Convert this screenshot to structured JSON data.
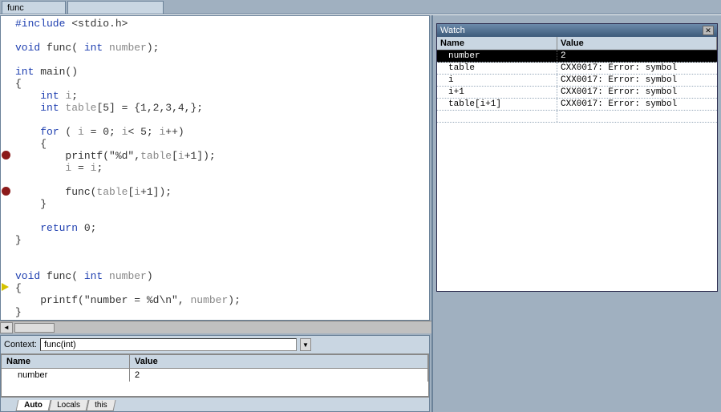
{
  "tabbar": {
    "active_tab": "func"
  },
  "code_lines": [
    {
      "indent": 0,
      "tokens": [
        [
          "kw",
          "#include"
        ],
        [
          "",
          ""
        ],
        [
          "str",
          " <stdio.h>"
        ]
      ]
    },
    {
      "indent": 0,
      "tokens": []
    },
    {
      "indent": 0,
      "tokens": [
        [
          "kw",
          "void"
        ],
        [
          "",
          " "
        ],
        [
          "",
          "func("
        ],
        [
          "",
          " "
        ],
        [
          "kw",
          "int"
        ],
        [
          "",
          " "
        ],
        [
          "gray",
          "number"
        ],
        [
          "",
          ");"
        ]
      ]
    },
    {
      "indent": 0,
      "tokens": []
    },
    {
      "indent": 0,
      "tokens": [
        [
          "kw",
          "int"
        ],
        [
          "",
          " "
        ],
        [
          "",
          "main()"
        ]
      ]
    },
    {
      "indent": 0,
      "tokens": [
        [
          "",
          "{"
        ]
      ]
    },
    {
      "indent": 1,
      "tokens": [
        [
          "kw",
          "int"
        ],
        [
          "",
          " "
        ],
        [
          "gray",
          "i"
        ],
        [
          "",
          ";"
        ]
      ]
    },
    {
      "indent": 1,
      "tokens": [
        [
          "kw",
          "int"
        ],
        [
          "",
          " "
        ],
        [
          "gray",
          "table"
        ],
        [
          "",
          "[5] = {1,2,3,4,};"
        ]
      ]
    },
    {
      "indent": 0,
      "tokens": []
    },
    {
      "indent": 1,
      "tokens": [
        [
          "kw",
          "for"
        ],
        [
          "",
          " ( "
        ],
        [
          "gray",
          "i"
        ],
        [
          "",
          " = 0; "
        ],
        [
          "gray",
          "i"
        ],
        [
          "",
          "< 5; "
        ],
        [
          "gray",
          "i"
        ],
        [
          "",
          "++)"
        ]
      ]
    },
    {
      "indent": 1,
      "tokens": [
        [
          "",
          "{"
        ]
      ]
    },
    {
      "indent": 2,
      "tokens": [
        [
          "",
          "printf("
        ],
        [
          "str",
          "\"%d\""
        ],
        [
          "",
          ","
        ],
        [
          "gray",
          "table"
        ],
        [
          "",
          "["
        ],
        [
          "gray",
          "i"
        ],
        [
          "",
          "+1]);"
        ]
      ],
      "bp": true
    },
    {
      "indent": 2,
      "tokens": [
        [
          "gray",
          "i"
        ],
        [
          "",
          " = "
        ],
        [
          "gray",
          "i"
        ],
        [
          "",
          ";"
        ]
      ]
    },
    {
      "indent": 0,
      "tokens": []
    },
    {
      "indent": 2,
      "tokens": [
        [
          "",
          "func("
        ],
        [
          "gray",
          "table"
        ],
        [
          "",
          "["
        ],
        [
          "gray",
          "i"
        ],
        [
          "",
          "+1]);"
        ]
      ],
      "bp": true
    },
    {
      "indent": 1,
      "tokens": [
        [
          "",
          "}"
        ]
      ]
    },
    {
      "indent": 0,
      "tokens": []
    },
    {
      "indent": 1,
      "tokens": [
        [
          "kw",
          "return"
        ],
        [
          "",
          " 0;"
        ]
      ]
    },
    {
      "indent": 0,
      "tokens": [
        [
          "",
          "}"
        ]
      ]
    },
    {
      "indent": 0,
      "tokens": []
    },
    {
      "indent": 0,
      "tokens": []
    },
    {
      "indent": 0,
      "tokens": [
        [
          "kw",
          "void"
        ],
        [
          "",
          " func( "
        ],
        [
          "kw",
          "int"
        ],
        [
          "",
          " "
        ],
        [
          "gray",
          "number"
        ],
        [
          "",
          ")"
        ]
      ]
    },
    {
      "indent": 0,
      "tokens": [
        [
          "",
          "{"
        ]
      ],
      "arrow": true
    },
    {
      "indent": 1,
      "tokens": [
        [
          "",
          "printf("
        ],
        [
          "str",
          "\"number = %d\\n\""
        ],
        [
          "",
          ", "
        ],
        [
          "gray",
          "number"
        ],
        [
          "",
          ");"
        ]
      ]
    },
    {
      "indent": 0,
      "tokens": [
        [
          "",
          "}"
        ]
      ]
    }
  ],
  "locals": {
    "context_label": "Context:",
    "context_value": "func(int)",
    "headers": {
      "name": "Name",
      "value": "Value"
    },
    "rows": [
      {
        "name": "number",
        "value": "2"
      }
    ],
    "tabs": [
      "Auto",
      "Locals",
      "this"
    ],
    "active_tab": 0
  },
  "watch": {
    "title": "Watch",
    "headers": {
      "name": "Name",
      "value": "Value"
    },
    "rows": [
      {
        "name": "number",
        "value": "2",
        "selected": true
      },
      {
        "name": "table",
        "value": "CXX0017: Error: symbol"
      },
      {
        "name": "i",
        "value": "CXX0017: Error: symbol"
      },
      {
        "name": "i+1",
        "value": "CXX0017: Error: symbol"
      },
      {
        "name": "table[i+1]",
        "value": "CXX0017: Error: symbol"
      }
    ]
  }
}
